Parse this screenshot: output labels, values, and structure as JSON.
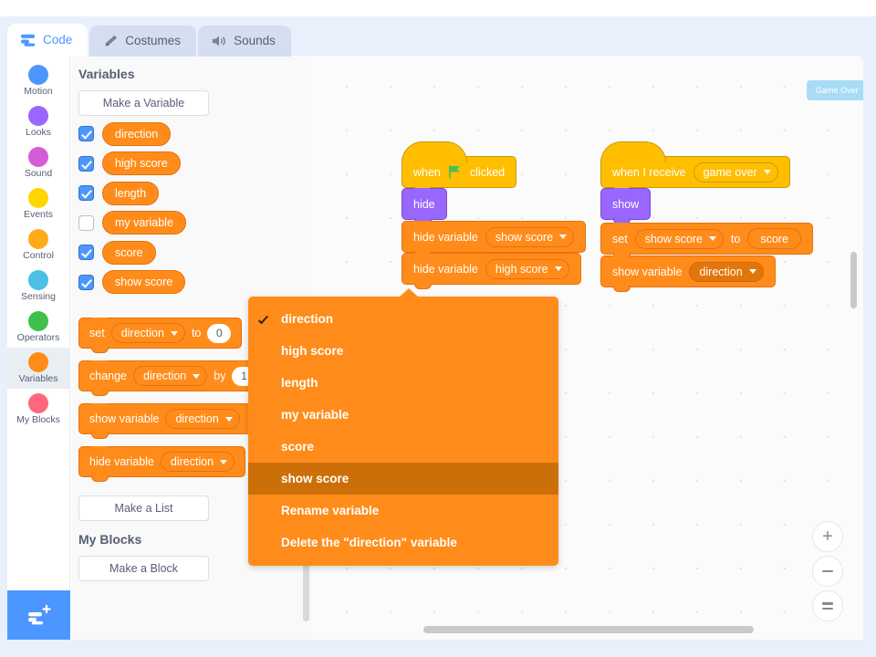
{
  "tabs": [
    {
      "label": "Code",
      "icon": "code-icon",
      "active": true
    },
    {
      "label": "Costumes",
      "icon": "brush-icon",
      "active": false
    },
    {
      "label": "Sounds",
      "icon": "speaker-icon",
      "active": false
    }
  ],
  "categories": [
    {
      "label": "Motion",
      "color": "#4c97ff",
      "selected": false
    },
    {
      "label": "Looks",
      "color": "#9966ff",
      "selected": false
    },
    {
      "label": "Sound",
      "color": "#d65cd6",
      "selected": false
    },
    {
      "label": "Events",
      "color": "#ffd500",
      "selected": false
    },
    {
      "label": "Control",
      "color": "#ffab19",
      "selected": false
    },
    {
      "label": "Sensing",
      "color": "#4cbfe6",
      "selected": false
    },
    {
      "label": "Operators",
      "color": "#40bf4a",
      "selected": false
    },
    {
      "label": "Variables",
      "color": "#ff8c1a",
      "selected": true
    },
    {
      "label": "My Blocks",
      "color": "#ff6680",
      "selected": false
    }
  ],
  "extension_button": {
    "name": "add-extension-button",
    "icon": "add-extension-icon"
  },
  "palette": {
    "variables_heading": "Variables",
    "make_variable_label": "Make a Variable",
    "variables": [
      {
        "name": "direction",
        "checked": true
      },
      {
        "name": "high score",
        "checked": true
      },
      {
        "name": "length",
        "checked": true
      },
      {
        "name": "my variable",
        "checked": false
      },
      {
        "name": "score",
        "checked": true
      },
      {
        "name": "show score",
        "checked": true
      }
    ],
    "blocks": [
      {
        "id": "set",
        "prefix": "set",
        "dropdown": "direction",
        "mid": "to",
        "value": "0"
      },
      {
        "id": "change",
        "prefix": "change",
        "dropdown": "direction",
        "mid": "by",
        "value": "1"
      },
      {
        "id": "show-variable",
        "prefix": "show variable",
        "dropdown": "direction",
        "mid": "",
        "value": ""
      },
      {
        "id": "hide-variable",
        "prefix": "hide variable",
        "dropdown": "direction",
        "mid": "",
        "value": ""
      }
    ],
    "make_list_label": "Make a List",
    "my_blocks_heading": "My Blocks",
    "make_block_label": "Make a Block"
  },
  "workspace": {
    "ghost_label": "Game Over",
    "script_one": {
      "hat_prefix": "when",
      "hat_suffix": "clicked",
      "hat_icon": "green-flag-icon",
      "block2": "hide",
      "block3_prefix": "hide variable",
      "block3_dropdown": "show score",
      "block4_prefix": "hide variable",
      "block4_dropdown": "high score"
    },
    "script_two": {
      "hat_prefix": "when I receive",
      "hat_dropdown": "game over",
      "block2": "show",
      "block3_prefix": "set",
      "block3_dropdown": "show score",
      "block3_mid": "to",
      "block3_reporter": "score",
      "block4_prefix": "show variable",
      "block4_dropdown": "direction"
    }
  },
  "dropdown_menu": {
    "items": [
      {
        "label": "direction",
        "checked": true,
        "selected": false
      },
      {
        "label": "high score",
        "checked": false,
        "selected": false
      },
      {
        "label": "length",
        "checked": false,
        "selected": false
      },
      {
        "label": "my variable",
        "checked": false,
        "selected": false
      },
      {
        "label": "score",
        "checked": false,
        "selected": false
      },
      {
        "label": "show score",
        "checked": false,
        "selected": true
      },
      {
        "label": "Rename variable",
        "checked": false,
        "selected": false
      },
      {
        "label": "Delete the \"direction\" variable",
        "checked": false,
        "selected": false
      }
    ]
  },
  "zoom_controls": [
    {
      "name": "zoom-in-button",
      "glyph": "+"
    },
    {
      "name": "zoom-out-button",
      "glyph": "−"
    },
    {
      "name": "zoom-reset-button",
      "glyph": "="
    }
  ]
}
